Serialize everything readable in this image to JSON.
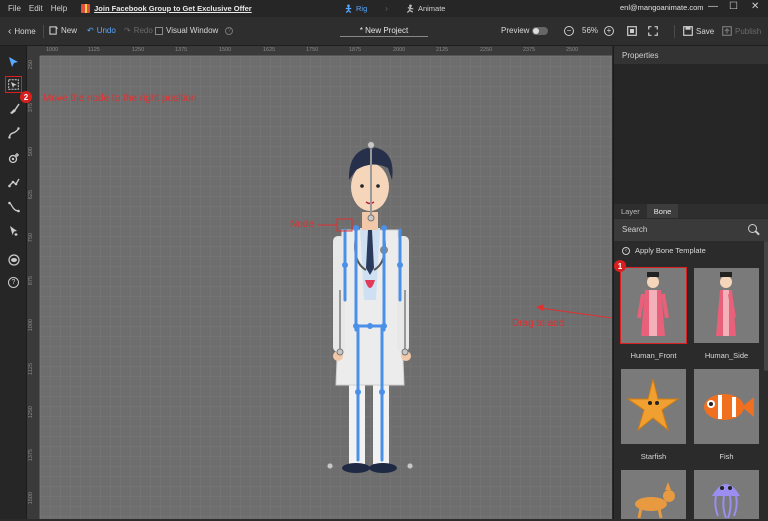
{
  "menu": {
    "file": "File",
    "edit": "Edit",
    "help": "Help",
    "promo": "Join Facebook Group to Get Exclusive Offer"
  },
  "modes": {
    "rig": "Rig",
    "animate": "Animate",
    "arrow": "›"
  },
  "account": {
    "email": "enl@mangoanimate.com"
  },
  "window_controls": {
    "minimize": "—",
    "maximize": "☐",
    "close": "✕"
  },
  "toolbar": {
    "home": "Home",
    "new": "New",
    "undo": "Undo",
    "redo": "Redo",
    "visual_window": "Visual Window",
    "project_title": "* New Project",
    "preview": "Preview",
    "zoom": "56%",
    "save": "Save",
    "publish": "Publish"
  },
  "rulers": {
    "top": [
      "1000",
      "1125",
      "1250",
      "1375",
      "1500",
      "1625",
      "1750",
      "1875",
      "2000",
      "2125",
      "2250",
      "2375",
      "2500"
    ],
    "left": [
      "250",
      "375",
      "500",
      "625",
      "750",
      "875",
      "1000",
      "1125",
      "1250",
      "1375",
      "1500"
    ]
  },
  "annotations": {
    "badge2": "2",
    "move_hint": "Move the node to the right position",
    "node": "Node",
    "drag": "Drag to add",
    "badge1": "1"
  },
  "panel": {
    "properties": "Properties",
    "tabs": [
      "Layer",
      "Bone"
    ],
    "search": "Search",
    "apply_template": "Apply Bone Template",
    "templates": [
      "Human_Front",
      "Human_Side",
      "Starfish",
      "Fish"
    ]
  },
  "colors": {
    "accent": "#5aa8ff",
    "annotation": "#e03030",
    "bone": "#4a90e8"
  }
}
